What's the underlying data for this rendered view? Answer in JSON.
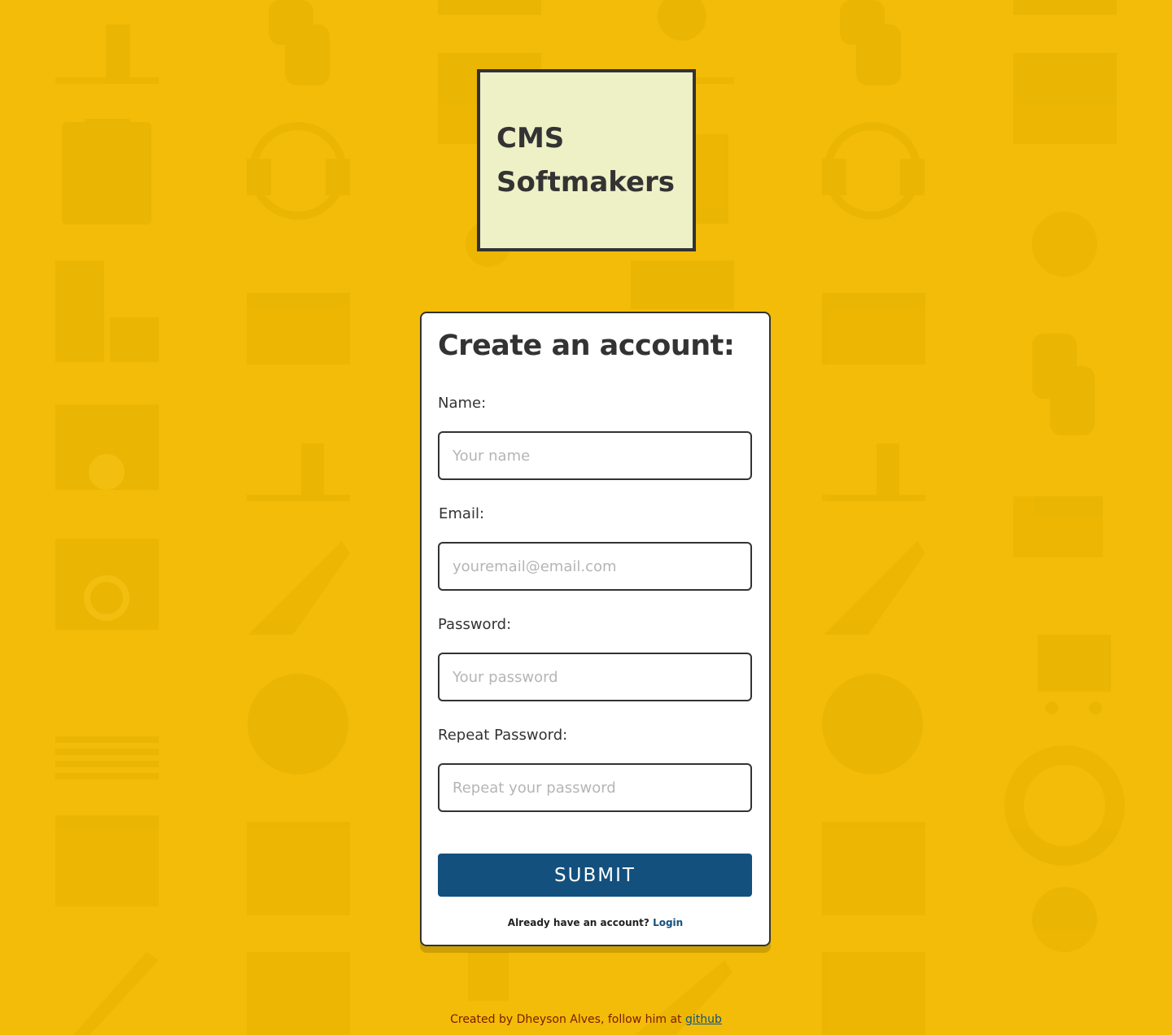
{
  "logo": {
    "text": "CMS Softmakers"
  },
  "form": {
    "title": "Create an account:",
    "fields": [
      {
        "label": "Name:",
        "placeholder": "Your name"
      },
      {
        "label": "Email:",
        "placeholder": "youremail@email.com"
      },
      {
        "label": "Password:",
        "placeholder": "Your password"
      },
      {
        "label": "Repeat Password:",
        "placeholder": "Repeat your password"
      }
    ],
    "submit_label": "SUBMIT",
    "login_prompt": "Already have an account?",
    "login_link": "Login"
  },
  "footer": {
    "text": "Created by Dheyson Alves, follow him at",
    "link": "github"
  },
  "colors": {
    "background": "#f2bc08",
    "logo_bg": "#eef0c6",
    "button": "#13507d",
    "footer_text": "#7a1b00"
  },
  "background_icons": [
    "toolbox-icon",
    "headset-icon",
    "network-icon",
    "puzzle-icon",
    "thumbs-up-icon",
    "chain-link-icon",
    "settings-window-icon",
    "line-chart-icon",
    "rocket-icon",
    "search-window-icon",
    "checklist-icon",
    "shopping-cart-icon",
    "globe-gear-icon",
    "lifebuoy-icon",
    "home-window-icon",
    "calendar-icon",
    "lightbulb-icon",
    "sitemap-window-icon",
    "bar-chart-icon"
  ]
}
